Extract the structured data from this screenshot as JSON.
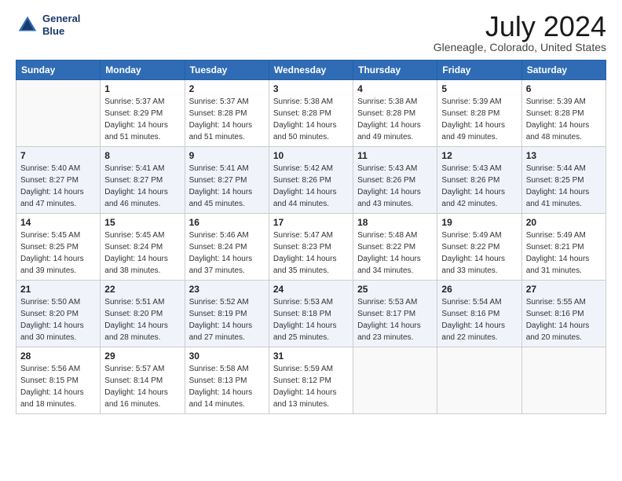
{
  "title": "July 2024",
  "subtitle": "Gleneagle, Colorado, United States",
  "logo": {
    "line1": "General",
    "line2": "Blue"
  },
  "headers": [
    "Sunday",
    "Monday",
    "Tuesday",
    "Wednesday",
    "Thursday",
    "Friday",
    "Saturday"
  ],
  "weeks": [
    [
      {
        "day": "",
        "sunrise": "",
        "sunset": "",
        "daylight": ""
      },
      {
        "day": "1",
        "sunrise": "Sunrise: 5:37 AM",
        "sunset": "Sunset: 8:29 PM",
        "daylight": "Daylight: 14 hours and 51 minutes."
      },
      {
        "day": "2",
        "sunrise": "Sunrise: 5:37 AM",
        "sunset": "Sunset: 8:28 PM",
        "daylight": "Daylight: 14 hours and 51 minutes."
      },
      {
        "day": "3",
        "sunrise": "Sunrise: 5:38 AM",
        "sunset": "Sunset: 8:28 PM",
        "daylight": "Daylight: 14 hours and 50 minutes."
      },
      {
        "day": "4",
        "sunrise": "Sunrise: 5:38 AM",
        "sunset": "Sunset: 8:28 PM",
        "daylight": "Daylight: 14 hours and 49 minutes."
      },
      {
        "day": "5",
        "sunrise": "Sunrise: 5:39 AM",
        "sunset": "Sunset: 8:28 PM",
        "daylight": "Daylight: 14 hours and 49 minutes."
      },
      {
        "day": "6",
        "sunrise": "Sunrise: 5:39 AM",
        "sunset": "Sunset: 8:28 PM",
        "daylight": "Daylight: 14 hours and 48 minutes."
      }
    ],
    [
      {
        "day": "7",
        "sunrise": "Sunrise: 5:40 AM",
        "sunset": "Sunset: 8:27 PM",
        "daylight": "Daylight: 14 hours and 47 minutes."
      },
      {
        "day": "8",
        "sunrise": "Sunrise: 5:41 AM",
        "sunset": "Sunset: 8:27 PM",
        "daylight": "Daylight: 14 hours and 46 minutes."
      },
      {
        "day": "9",
        "sunrise": "Sunrise: 5:41 AM",
        "sunset": "Sunset: 8:27 PM",
        "daylight": "Daylight: 14 hours and 45 minutes."
      },
      {
        "day": "10",
        "sunrise": "Sunrise: 5:42 AM",
        "sunset": "Sunset: 8:26 PM",
        "daylight": "Daylight: 14 hours and 44 minutes."
      },
      {
        "day": "11",
        "sunrise": "Sunrise: 5:43 AM",
        "sunset": "Sunset: 8:26 PM",
        "daylight": "Daylight: 14 hours and 43 minutes."
      },
      {
        "day": "12",
        "sunrise": "Sunrise: 5:43 AM",
        "sunset": "Sunset: 8:26 PM",
        "daylight": "Daylight: 14 hours and 42 minutes."
      },
      {
        "day": "13",
        "sunrise": "Sunrise: 5:44 AM",
        "sunset": "Sunset: 8:25 PM",
        "daylight": "Daylight: 14 hours and 41 minutes."
      }
    ],
    [
      {
        "day": "14",
        "sunrise": "Sunrise: 5:45 AM",
        "sunset": "Sunset: 8:25 PM",
        "daylight": "Daylight: 14 hours and 39 minutes."
      },
      {
        "day": "15",
        "sunrise": "Sunrise: 5:45 AM",
        "sunset": "Sunset: 8:24 PM",
        "daylight": "Daylight: 14 hours and 38 minutes."
      },
      {
        "day": "16",
        "sunrise": "Sunrise: 5:46 AM",
        "sunset": "Sunset: 8:24 PM",
        "daylight": "Daylight: 14 hours and 37 minutes."
      },
      {
        "day": "17",
        "sunrise": "Sunrise: 5:47 AM",
        "sunset": "Sunset: 8:23 PM",
        "daylight": "Daylight: 14 hours and 35 minutes."
      },
      {
        "day": "18",
        "sunrise": "Sunrise: 5:48 AM",
        "sunset": "Sunset: 8:22 PM",
        "daylight": "Daylight: 14 hours and 34 minutes."
      },
      {
        "day": "19",
        "sunrise": "Sunrise: 5:49 AM",
        "sunset": "Sunset: 8:22 PM",
        "daylight": "Daylight: 14 hours and 33 minutes."
      },
      {
        "day": "20",
        "sunrise": "Sunrise: 5:49 AM",
        "sunset": "Sunset: 8:21 PM",
        "daylight": "Daylight: 14 hours and 31 minutes."
      }
    ],
    [
      {
        "day": "21",
        "sunrise": "Sunrise: 5:50 AM",
        "sunset": "Sunset: 8:20 PM",
        "daylight": "Daylight: 14 hours and 30 minutes."
      },
      {
        "day": "22",
        "sunrise": "Sunrise: 5:51 AM",
        "sunset": "Sunset: 8:20 PM",
        "daylight": "Daylight: 14 hours and 28 minutes."
      },
      {
        "day": "23",
        "sunrise": "Sunrise: 5:52 AM",
        "sunset": "Sunset: 8:19 PM",
        "daylight": "Daylight: 14 hours and 27 minutes."
      },
      {
        "day": "24",
        "sunrise": "Sunrise: 5:53 AM",
        "sunset": "Sunset: 8:18 PM",
        "daylight": "Daylight: 14 hours and 25 minutes."
      },
      {
        "day": "25",
        "sunrise": "Sunrise: 5:53 AM",
        "sunset": "Sunset: 8:17 PM",
        "daylight": "Daylight: 14 hours and 23 minutes."
      },
      {
        "day": "26",
        "sunrise": "Sunrise: 5:54 AM",
        "sunset": "Sunset: 8:16 PM",
        "daylight": "Daylight: 14 hours and 22 minutes."
      },
      {
        "day": "27",
        "sunrise": "Sunrise: 5:55 AM",
        "sunset": "Sunset: 8:16 PM",
        "daylight": "Daylight: 14 hours and 20 minutes."
      }
    ],
    [
      {
        "day": "28",
        "sunrise": "Sunrise: 5:56 AM",
        "sunset": "Sunset: 8:15 PM",
        "daylight": "Daylight: 14 hours and 18 minutes."
      },
      {
        "day": "29",
        "sunrise": "Sunrise: 5:57 AM",
        "sunset": "Sunset: 8:14 PM",
        "daylight": "Daylight: 14 hours and 16 minutes."
      },
      {
        "day": "30",
        "sunrise": "Sunrise: 5:58 AM",
        "sunset": "Sunset: 8:13 PM",
        "daylight": "Daylight: 14 hours and 14 minutes."
      },
      {
        "day": "31",
        "sunrise": "Sunrise: 5:59 AM",
        "sunset": "Sunset: 8:12 PM",
        "daylight": "Daylight: 14 hours and 13 minutes."
      },
      {
        "day": "",
        "sunrise": "",
        "sunset": "",
        "daylight": ""
      },
      {
        "day": "",
        "sunrise": "",
        "sunset": "",
        "daylight": ""
      },
      {
        "day": "",
        "sunrise": "",
        "sunset": "",
        "daylight": ""
      }
    ]
  ]
}
